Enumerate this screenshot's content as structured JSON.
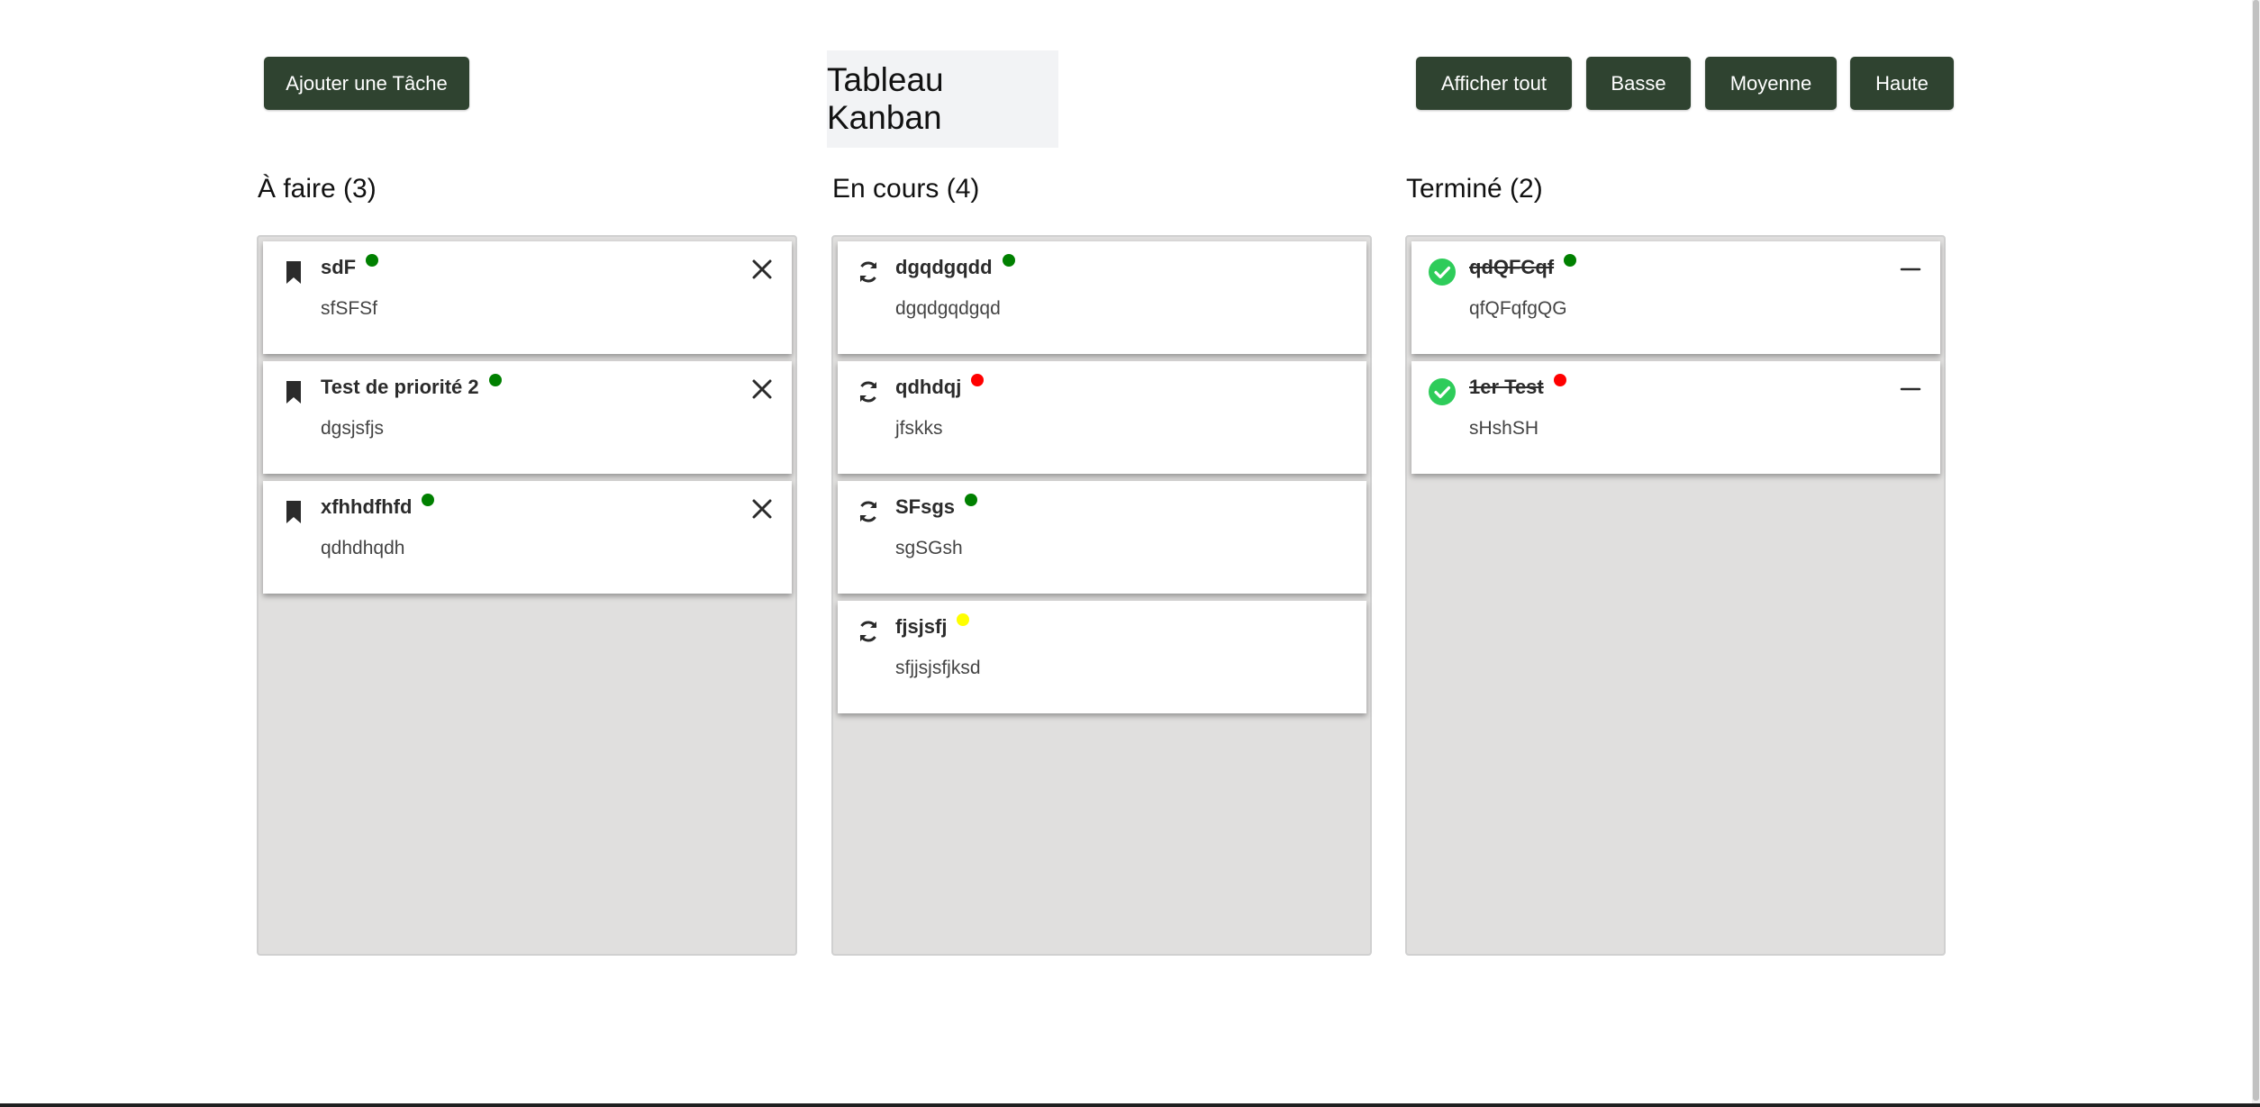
{
  "header": {
    "add_task_label": "Ajouter une Tâche",
    "board_title": "Tableau Kanban",
    "filters": {
      "all": "Afficher tout",
      "low": "Basse",
      "medium": "Moyenne",
      "high": "Haute"
    }
  },
  "colors": {
    "button_bg": "#2f4330",
    "column_bg": "#e0dfde",
    "priority_low": "#008000",
    "priority_medium": "#ffff00",
    "priority_high": "#ff0000",
    "done_check": "#2ecc5a"
  },
  "columns": [
    {
      "heading": "À faire (3)",
      "status_icon": "bookmark-icon",
      "action_icon": "close-icon",
      "cards": [
        {
          "title": "sdF",
          "description": "sfSFSf",
          "priority_color": "#008000"
        },
        {
          "title": "Test de priorité 2",
          "description": "dgsjsfjs",
          "priority_color": "#008000"
        },
        {
          "title": "xfhhdfhfd",
          "description": "qdhdhqdh",
          "priority_color": "#008000"
        }
      ]
    },
    {
      "heading": "En cours (4)",
      "status_icon": "refresh-icon",
      "action_icon": "",
      "cards": [
        {
          "title": "dgqdgqdd",
          "description": "dgqdgqdgqd",
          "priority_color": "#008000"
        },
        {
          "title": "qdhdqj",
          "description": "jfskks",
          "priority_color": "#ff0000"
        },
        {
          "title": "SFsgs",
          "description": "sgSGsh",
          "priority_color": "#008000"
        },
        {
          "title": "fjsjsfj",
          "description": "sfjjsjsfjksd",
          "priority_color": "#ffff00"
        }
      ]
    },
    {
      "heading": "Terminé (2)",
      "status_icon": "check-circle-icon",
      "action_icon": "minus-icon",
      "cards": [
        {
          "title": "qdQFCqf",
          "description": "qfQFqfgQG",
          "priority_color": "#008000"
        },
        {
          "title": "1er Test",
          "description": "sHshSH",
          "priority_color": "#ff0000"
        }
      ]
    }
  ]
}
